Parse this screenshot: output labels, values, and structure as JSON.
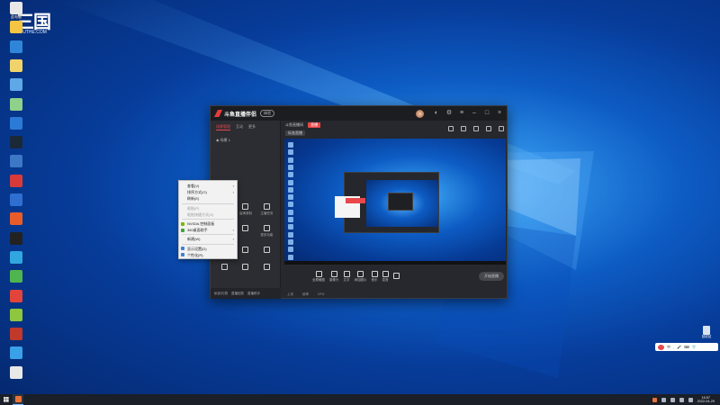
{
  "desktop": {
    "watermark": {
      "mark": "三国",
      "sub": "SOUTHE.COM"
    },
    "icons": [
      {
        "label": "此电脑",
        "color": "#e8e8e8"
      },
      {
        "label": "",
        "color": "#f4c542"
      },
      {
        "label": "",
        "color": "#2f86d8"
      },
      {
        "label": "",
        "color": "#f0d36a"
      },
      {
        "label": "",
        "color": "#5fa8e8"
      },
      {
        "label": "",
        "color": "#8fd18a"
      },
      {
        "label": "",
        "color": "#2b7ad6"
      },
      {
        "label": "",
        "color": "#1b2838"
      },
      {
        "label": "",
        "color": "#3c78c6"
      },
      {
        "label": "",
        "color": "#d83a3a"
      },
      {
        "label": "",
        "color": "#2f6fd0"
      },
      {
        "label": "",
        "color": "#e85c2a"
      },
      {
        "label": "",
        "color": "#222222"
      },
      {
        "label": "",
        "color": "#31a6e0"
      },
      {
        "label": "",
        "color": "#4fb64f"
      },
      {
        "label": "",
        "color": "#e2443b"
      },
      {
        "label": "",
        "color": "#8ec63f"
      },
      {
        "label": "",
        "color": "#c0392b"
      },
      {
        "label": "",
        "color": "#3aa0e8"
      },
      {
        "label": "",
        "color": "#e8e8e8"
      }
    ],
    "recycle_bin": {
      "label": "回收站"
    }
  },
  "app": {
    "name": "斗鱼直播伴侣",
    "version_badge": "体验",
    "sidebar_tabs": [
      "场景管理",
      "互动",
      "更多"
    ],
    "scene_label": "场景 1",
    "tools": [
      "",
      "高清录制",
      "主播任务",
      "",
      "",
      "更多功能",
      "",
      "",
      "",
      "",
      "",
      ""
    ],
    "sidebar_footer": [
      "私信/礼物",
      "直播回放",
      "直播助手"
    ],
    "room_title": "斗鱼直播间",
    "live_tag": "直播",
    "sub_tag": "标准直播",
    "controls": [
      {
        "label": "全屏截图"
      },
      {
        "label": "摄像头"
      },
      {
        "label": "文字"
      },
      {
        "label": "添加图片"
      },
      {
        "label": "音乐"
      },
      {
        "label": "混音"
      },
      {
        "label": ""
      }
    ],
    "start_live": "开始直播",
    "status_left": [
      "上传",
      "帧率",
      "CPU"
    ]
  },
  "context_menu": {
    "items": [
      {
        "label": "查看(V)",
        "submenu": true,
        "disabled": false,
        "icon": ""
      },
      {
        "label": "排序方式(O)",
        "submenu": true,
        "disabled": false,
        "icon": ""
      },
      {
        "label": "刷新(E)",
        "submenu": false,
        "disabled": false,
        "icon": ""
      },
      {
        "sep": true
      },
      {
        "label": "粘贴(P)",
        "submenu": false,
        "disabled": true,
        "icon": ""
      },
      {
        "label": "粘贴快捷方式(S)",
        "submenu": false,
        "disabled": true,
        "icon": ""
      },
      {
        "sep": true
      },
      {
        "label": "NVIDIA 控制面板",
        "submenu": false,
        "disabled": false,
        "icon": "#76b900"
      },
      {
        "label": "360桌面助手",
        "submenu": true,
        "disabled": false,
        "icon": "#3fa33a"
      },
      {
        "sep": true
      },
      {
        "label": "新建(W)",
        "submenu": true,
        "disabled": false,
        "icon": ""
      },
      {
        "sep": true
      },
      {
        "label": "显示设置(D)",
        "submenu": false,
        "disabled": false,
        "icon": "#3b82d6"
      },
      {
        "label": "个性化(R)",
        "submenu": false,
        "disabled": false,
        "icon": "#3b82d6"
      }
    ]
  },
  "taskbar": {
    "time": "16:57",
    "date": "2022-04-29"
  }
}
